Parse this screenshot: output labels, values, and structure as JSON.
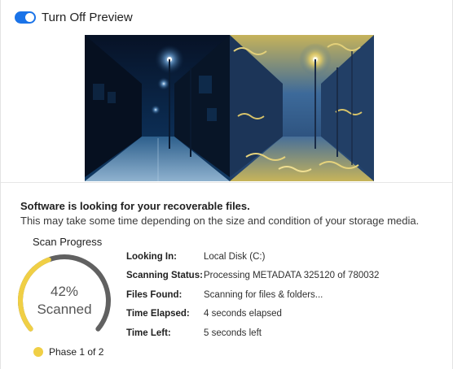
{
  "preview_toggle": {
    "label": "Turn Off Preview",
    "state": "on",
    "color": "#1a73e8"
  },
  "status": {
    "headline": "Software is looking for your recoverable files.",
    "subline": "This may take some time depending on the size and condition of your storage media."
  },
  "progress": {
    "title": "Scan Progress",
    "percent": 42,
    "percent_text": "42%",
    "caption": "Scanned",
    "phase": "Phase 1 of 2",
    "fill_color": "#f0cf45",
    "track_color": "#616161"
  },
  "details": [
    {
      "label": "Looking In:",
      "value": "Local Disk (C:)"
    },
    {
      "label": "Scanning Status:",
      "value": "Processing METADATA 325120 of 780032"
    },
    {
      "label": "Files Found:",
      "value": "Scanning for files & folders..."
    },
    {
      "label": "Time Elapsed:",
      "value": "4 seconds elapsed"
    },
    {
      "label": "Time Left:",
      "value": "5 seconds left"
    }
  ]
}
